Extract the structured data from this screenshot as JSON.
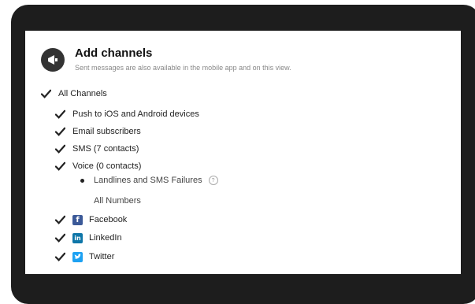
{
  "header": {
    "title": "Add channels",
    "subtitle": "Sent messages are also available in the mobile app and on this view."
  },
  "channels": {
    "all": "All Channels",
    "push": "Push to iOS and Android devices",
    "email": "Email subscribers",
    "sms": "SMS (7 contacts)",
    "voice": "Voice (0 contacts)",
    "landlines": "Landlines and SMS Failures",
    "all_numbers": "All Numbers",
    "facebook": "Facebook",
    "linkedin": "LinkedIn",
    "twitter": "Twitter"
  },
  "icons": {
    "header": "megaphone-icon",
    "check": "checkmark-icon",
    "help": "help-icon",
    "facebook": "facebook-icon",
    "linkedin": "linkedin-icon",
    "twitter": "twitter-icon"
  },
  "colors": {
    "facebook": "#3b5998",
    "linkedin": "#0e76a8",
    "twitter": "#1da1f2",
    "frame": "#1d1d1d"
  }
}
